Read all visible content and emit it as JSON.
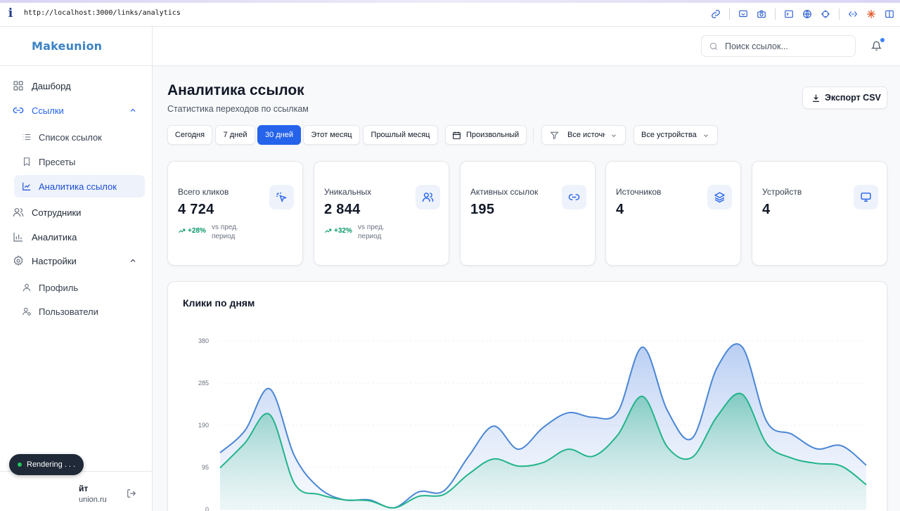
{
  "browser": {
    "url": "http://localhost:3000/links/analytics"
  },
  "sidebar": {
    "logo": "Makeunion",
    "items": [
      {
        "label": "Дашборд"
      },
      {
        "label": "Ссылки"
      },
      {
        "label": "Сотрудники"
      },
      {
        "label": "Аналитика"
      },
      {
        "label": "Настройки"
      }
    ],
    "links_sub": [
      {
        "label": "Список ссылок"
      },
      {
        "label": "Пресеты"
      },
      {
        "label": "Аналитика ссылок"
      }
    ],
    "settings_sub": [
      {
        "label": "Профиль"
      },
      {
        "label": "Пользователи"
      }
    ],
    "user": {
      "name": "йт",
      "email": "union.ru"
    },
    "rendering_badge": "Rendering . . ."
  },
  "header": {
    "search_placeholder": "Поиск ссылок...",
    "has_notification": true
  },
  "page": {
    "title": "Аналитика ссылок",
    "subtitle": "Статистика переходов по ссылкам",
    "export_label": "Экспорт CSV"
  },
  "filters": {
    "periods": [
      "Сегодня",
      "7 дней",
      "30 дней",
      "Этот месяц",
      "Прошлый месяц"
    ],
    "active_period": "30 дней",
    "custom_label": "Произвольный",
    "source_value": "Все источники",
    "device_value": "Все устройства"
  },
  "stats": [
    {
      "label": "Всего кликов",
      "value": "4 724",
      "delta": "+28%",
      "note": "vs пред. период",
      "icon": "cursor-click-icon"
    },
    {
      "label": "Уникальных",
      "value": "2 844",
      "delta": "+32%",
      "note": "vs пред. период",
      "icon": "users-icon"
    },
    {
      "label": "Активных ссылок",
      "value": "195",
      "icon": "link-icon"
    },
    {
      "label": "Источников",
      "value": "4",
      "icon": "layers-icon"
    },
    {
      "label": "Устройств",
      "value": "4",
      "icon": "monitor-icon"
    }
  ],
  "colors": {
    "accent": "#2563eb",
    "series_total": "#4a86d4",
    "series_unique": "#22b48a",
    "positive": "#059669"
  },
  "chart_data": {
    "type": "area",
    "title": "Клики по дням",
    "ylim": [
      0,
      380
    ],
    "yticks": [
      0,
      95,
      190,
      285,
      380
    ],
    "grid": true,
    "series": [
      {
        "key": "total",
        "values": [
          128,
          178,
          272,
          120,
          48,
          22,
          22,
          4,
          40,
          42,
          120,
          188,
          136,
          185,
          218,
          208,
          220,
          366,
          223,
          161,
          320,
          367,
          198,
          170,
          137,
          144,
          100
        ]
      },
      {
        "key": "unique",
        "values": [
          94,
          150,
          214,
          58,
          34,
          22,
          20,
          4,
          30,
          34,
          80,
          114,
          98,
          106,
          136,
          120,
          168,
          255,
          141,
          118,
          210,
          260,
          148,
          116,
          104,
          98,
          56
        ]
      }
    ]
  }
}
